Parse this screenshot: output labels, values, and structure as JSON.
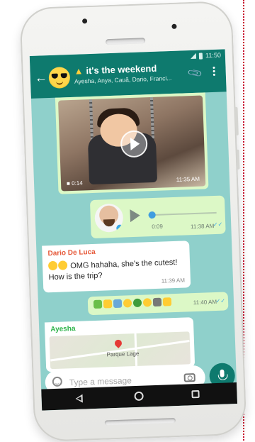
{
  "status_bar": {
    "time": "11:50"
  },
  "header": {
    "title": "it's the weekend",
    "participants": "Ayesha, Anya, Cauã, Dario, Franci..."
  },
  "messages": {
    "video": {
      "duration": "0:14",
      "time": "11:35 AM"
    },
    "voice": {
      "duration": "0:09",
      "time": "11:38 AM",
      "progress": 0.05
    },
    "dario": {
      "sender": "Dario De Luca",
      "text": "OMG hahaha, she's the cutest! How is the trip?",
      "time": "11:39 AM"
    },
    "emoji": {
      "time": "11:40 AM"
    },
    "location": {
      "sender": "Ayesha",
      "place": "Parque Lage"
    }
  },
  "composer": {
    "placeholder": "Type a message"
  },
  "colors": {
    "app_bar": "#0e7a6e",
    "chat_background": "#8fd0cb",
    "outgoing_bubble": "#dcf8c6",
    "incoming_bubble": "#ffffff",
    "sender_dario": "#e65a3b",
    "sender_ayesha": "#2db34a"
  },
  "icons": {
    "back": "arrow-left-icon",
    "attach": "paperclip-icon",
    "menu": "more-vert-icon",
    "emoji": "smiley-icon",
    "camera": "camera-icon",
    "mic": "mic-icon"
  }
}
